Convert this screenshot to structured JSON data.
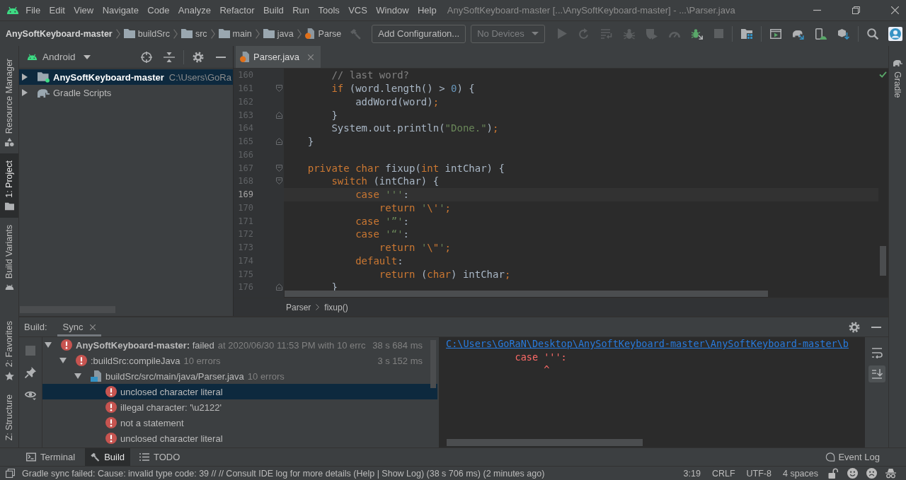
{
  "menu_bar": {
    "items": [
      "File",
      "Edit",
      "View",
      "Navigate",
      "Code",
      "Analyze",
      "Refactor",
      "Build",
      "Run",
      "Tools",
      "VCS",
      "Window",
      "Help"
    ],
    "window_title": "AnySoftKeyboard-master [...\\AnySoftKeyboard-master] - ...\\Parser.java"
  },
  "navigation_bar": {
    "breadcrumbs": [
      {
        "label": "AnySoftKeyboard-master",
        "kind": "project"
      },
      {
        "label": "buildSrc",
        "kind": "folder"
      },
      {
        "label": "src",
        "kind": "folder"
      },
      {
        "label": "main",
        "kind": "folder"
      },
      {
        "label": "java",
        "kind": "folder"
      },
      {
        "label": "Parse",
        "kind": "file"
      }
    ],
    "make_tool": {
      "enabled": false
    },
    "run_configuration": "Add Configuration...",
    "device": "No Devices",
    "tool_groups": [
      [
        {
          "kind": "run",
          "enabled": false
        },
        {
          "kind": "apply_restart",
          "enabled": false
        },
        {
          "kind": "apply_code",
          "enabled": false
        },
        {
          "kind": "debug",
          "enabled": false
        },
        {
          "kind": "coverage",
          "enabled": false
        },
        {
          "kind": "profile",
          "enabled": false
        },
        {
          "kind": "attach_debugger",
          "enabled": true
        },
        {
          "kind": "stop",
          "enabled": false
        }
      ],
      [
        {
          "kind": "project_structure",
          "enabled": true
        }
      ],
      [
        {
          "kind": "sdk_window",
          "enabled": true
        },
        {
          "kind": "gradle_sync",
          "enabled": true
        },
        {
          "kind": "avd_manager",
          "enabled": true
        },
        {
          "kind": "sdk_manager",
          "enabled": true
        }
      ],
      [
        {
          "kind": "search",
          "enabled": true
        },
        {
          "kind": "account",
          "enabled": true
        }
      ]
    ]
  },
  "left_strip": {
    "top": [
      {
        "label": "Resource Manager",
        "kind": "resource_manager",
        "selected": false
      },
      {
        "label": "1: Project",
        "kind": "project",
        "selected": true
      },
      {
        "label": "Build Variants",
        "kind": "build_variants",
        "selected": false
      }
    ],
    "bottom": [
      {
        "label": "2: Favorites",
        "kind": "favorites",
        "selected": false
      },
      {
        "label": "Z: Structure",
        "kind": "structure",
        "selected": false
      }
    ]
  },
  "right_strip": [
    {
      "label": "Gradle",
      "kind": "gradle",
      "selected": false
    }
  ],
  "project_panel": {
    "view": "Android",
    "tree": [
      {
        "label": "AnySoftKeyboard-master",
        "path": "C:\\Users\\GoRa",
        "kind": "module",
        "expanded": false,
        "selected": true
      },
      {
        "label": "Gradle Scripts",
        "kind": "gradle",
        "expanded": false,
        "selected": false
      }
    ]
  },
  "editor": {
    "tabs": [
      {
        "label": "Parser.java",
        "selected": true
      }
    ],
    "lines": [
      {
        "number": "160",
        "current": false,
        "kind": "plain",
        "tokens": [
          {
            "kind": "cmt",
            "text": "        // last word?"
          }
        ]
      },
      {
        "number": "161",
        "current": false,
        "kind": "fold_start",
        "tokens": [
          {
            "kind": "kw",
            "text": "        if"
          },
          {
            "kind": "plain",
            "text": " (word.length() > "
          },
          {
            "kind": "num",
            "text": "0"
          },
          {
            "kind": "plain",
            "text": ") {"
          }
        ]
      },
      {
        "number": "162",
        "current": false,
        "kind": "plain",
        "tokens": [
          {
            "kind": "plain",
            "text": "            addWord(word)"
          },
          {
            "kind": "semi",
            "text": ";"
          }
        ]
      },
      {
        "number": "163",
        "current": false,
        "kind": "fold_end",
        "tokens": [
          {
            "kind": "plain",
            "text": "        }"
          }
        ]
      },
      {
        "number": "164",
        "current": false,
        "kind": "plain",
        "tokens": [
          {
            "kind": "plain",
            "text": "        System.out.println("
          },
          {
            "kind": "str",
            "text": "\"Done.\""
          },
          {
            "kind": "plain",
            "text": ")"
          },
          {
            "kind": "semi",
            "text": ";"
          }
        ]
      },
      {
        "number": "165",
        "current": false,
        "kind": "fold_end",
        "tokens": [
          {
            "kind": "plain",
            "text": "    }"
          }
        ]
      },
      {
        "number": "166",
        "current": false,
        "kind": "plain"
      },
      {
        "number": "167",
        "current": false,
        "kind": "fold_start",
        "tokens": [
          {
            "kind": "kw",
            "text": "    private char"
          },
          {
            "kind": "plain",
            "text": " fixup("
          },
          {
            "kind": "kw",
            "text": "int"
          },
          {
            "kind": "plain",
            "text": " intChar) {"
          }
        ]
      },
      {
        "number": "168",
        "current": false,
        "kind": "fold_start",
        "tokens": [
          {
            "kind": "kw",
            "text": "        switch"
          },
          {
            "kind": "plain",
            "text": " (intChar) {"
          }
        ]
      },
      {
        "number": "169",
        "current": true,
        "kind": "plain",
        "tokens": [
          {
            "kind": "kw",
            "text": "            case "
          },
          {
            "kind": "str",
            "text": "'''"
          },
          {
            "kind": "plain",
            "text": ":"
          }
        ]
      },
      {
        "number": "170",
        "current": false,
        "kind": "plain",
        "tokens": [
          {
            "kind": "kw",
            "text": "                return "
          },
          {
            "kind": "str",
            "text": "'"
          },
          {
            "kind": "esc",
            "text": "\\'"
          },
          {
            "kind": "str",
            "text": "'"
          },
          {
            "kind": "semi",
            "text": ";"
          }
        ]
      },
      {
        "number": "171",
        "current": false,
        "kind": "plain",
        "tokens": [
          {
            "kind": "kw",
            "text": "            case "
          },
          {
            "kind": "str",
            "text": "'”'"
          },
          {
            "kind": "plain",
            "text": ":"
          }
        ]
      },
      {
        "number": "172",
        "current": false,
        "kind": "plain",
        "tokens": [
          {
            "kind": "kw",
            "text": "            case "
          },
          {
            "kind": "str",
            "text": "'“'"
          },
          {
            "kind": "plain",
            "text": ":"
          }
        ]
      },
      {
        "number": "173",
        "current": false,
        "kind": "plain",
        "tokens": [
          {
            "kind": "kw",
            "text": "                return "
          },
          {
            "kind": "str",
            "text": "'"
          },
          {
            "kind": "esc",
            "text": "\\\""
          },
          {
            "kind": "str",
            "text": "'"
          },
          {
            "kind": "semi",
            "text": ";"
          }
        ]
      },
      {
        "number": "174",
        "current": false,
        "kind": "plain",
        "tokens": [
          {
            "kind": "kw",
            "text": "            default"
          },
          {
            "kind": "plain",
            "text": ":"
          }
        ]
      },
      {
        "number": "175",
        "current": false,
        "kind": "plain",
        "tokens": [
          {
            "kind": "kw",
            "text": "                return "
          },
          {
            "kind": "plain",
            "text": "("
          },
          {
            "kind": "kw",
            "text": "char"
          },
          {
            "kind": "plain",
            "text": ") intChar"
          },
          {
            "kind": "semi",
            "text": ";"
          }
        ]
      },
      {
        "number": "176",
        "current": false,
        "kind": "fold_end",
        "tokens": [
          {
            "kind": "plain",
            "text": "        }"
          }
        ]
      }
    ],
    "breadcrumbs": [
      "Parser",
      "fixup()"
    ]
  },
  "build_panel": {
    "title": "Build:",
    "tabs": [
      {
        "label": "Sync",
        "selected": true
      }
    ],
    "tree": [
      {
        "label": "**AnySoftKeyboard-master:** failed",
        "note": "at 2020/06/30 11:53 PM with 10 errc",
        "time": "38 s 684 ms",
        "kind": "error",
        "expanded": true,
        "selected": false,
        "children": [
          {
            "label": ":buildSrc:compileJava",
            "note": "10 errors",
            "time": "3 s 152 ms",
            "kind": "error",
            "expanded": true,
            "selected": false,
            "children": [
              {
                "label": "buildSrc/src/main/java/Parser.java",
                "note": "10 errors",
                "kind": "file",
                "expanded": true,
                "selected": false,
                "children": [
                  {
                    "label": "unclosed character literal",
                    "kind": "error",
                    "selected": true
                  },
                  {
                    "label": "illegal character: '\\u2122'",
                    "kind": "error",
                    "selected": false
                  },
                  {
                    "label": "not a statement",
                    "kind": "error",
                    "selected": false
                  },
                  {
                    "label": "unclosed character literal",
                    "kind": "error",
                    "selected": false
                  }
                ]
              }
            ]
          }
        ]
      }
    ],
    "console": [
      {
        "kind": "link",
        "text": "C:\\Users\\GoRaN\\Desktop\\AnySoftKeyboard-master\\AnySoftKeyboard-master\\b"
      },
      {
        "kind": "error",
        "text": "            case ''':"
      },
      {
        "kind": "error",
        "text": "                 ^"
      }
    ],
    "console_tools": [
      {
        "kind": "soft_wrap",
        "on": false
      },
      {
        "kind": "scroll_to_end",
        "on": true
      }
    ]
  },
  "tool_window_bar": {
    "tabs": [
      {
        "label": "Terminal",
        "kind": "terminal",
        "selected": false
      },
      {
        "label": "Build",
        "kind": "build",
        "selected": true
      },
      {
        "label": "TODO",
        "kind": "todo",
        "selected": false
      }
    ],
    "event_log": "Event Log"
  },
  "status_bar": {
    "message": "Gradle sync failed: Cause: invalid type code: 39 // // Consult IDE log for more details (Help | Show Log) (38 s 706 ms) (2 minutes ago)",
    "items": [
      "3:19",
      "CRLF",
      "UTF-8",
      "4 spaces"
    ]
  }
}
